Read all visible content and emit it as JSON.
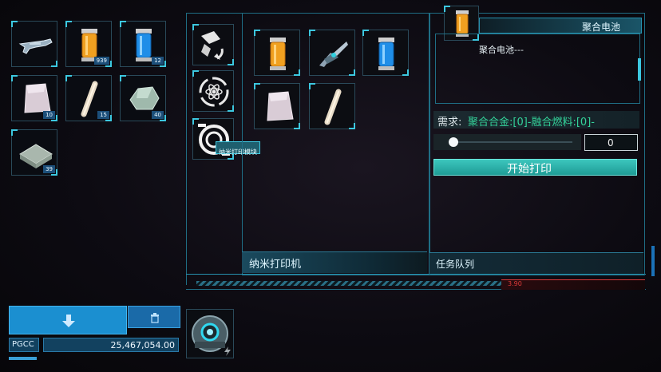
{
  "inventory": {
    "items": [
      {
        "name": "rifle",
        "count": ""
      },
      {
        "name": "orange-battery",
        "count": "939"
      },
      {
        "name": "blue-battery",
        "count": "12"
      },
      {
        "name": "alloy-plate",
        "count": "10"
      },
      {
        "name": "bone-cylinder",
        "count": "15"
      },
      {
        "name": "green-crystal",
        "count": "40"
      },
      {
        "name": "metal-bars",
        "count": "39"
      }
    ]
  },
  "modules": {
    "tooltip": "纳米打印模块"
  },
  "printer": {
    "panel_label": "纳米打印机"
  },
  "queue": {
    "panel_label": "任务队列"
  },
  "detail": {
    "title": "聚合电池",
    "description": "聚合电池---",
    "requirement_prefix": "需求:",
    "requirement_text": "聚合合金:[0]-融合燃料:[0]-",
    "quantity": "0",
    "start_button": "开始打印",
    "progress_value": "3.90"
  },
  "wallet": {
    "currency_label": "PGCC",
    "amount": "25,467,054.00"
  },
  "colors": {
    "accent": "#3cc8e0",
    "button": "#2fb3ad",
    "requirement": "#34d39a",
    "alert": "#d83a3a"
  }
}
